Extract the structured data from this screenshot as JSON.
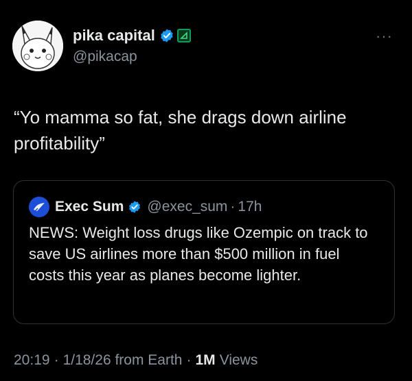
{
  "author": {
    "display_name": "pika capital",
    "handle": "@pikacap"
  },
  "tweet": {
    "text": "“Yo mamma so fat, she drags down airline profitability”"
  },
  "quoted_tweet": {
    "display_name": "Exec Sum",
    "handle": "@exec_sum",
    "separator": "·",
    "time": "17h",
    "text": "NEWS: Weight loss drugs like Ozempic on track to save US airlines more than $500 million in fuel costs this year as planes become lighter."
  },
  "meta": {
    "time": "20:19",
    "separator": "·",
    "date": "1/18/26 from Earth",
    "separator2": "·",
    "views_count": "1M",
    "views_label": "Views"
  },
  "colors": {
    "background": "#000000",
    "text": "#e7e9ea",
    "secondary_text": "#8b949e",
    "verified_blue": "#1d9bf0",
    "border": "#2f3336"
  },
  "icons": {
    "more": "more-horizontal-icon",
    "verified": "verified-badge-icon",
    "affiliate": "affiliate-badge-icon"
  }
}
